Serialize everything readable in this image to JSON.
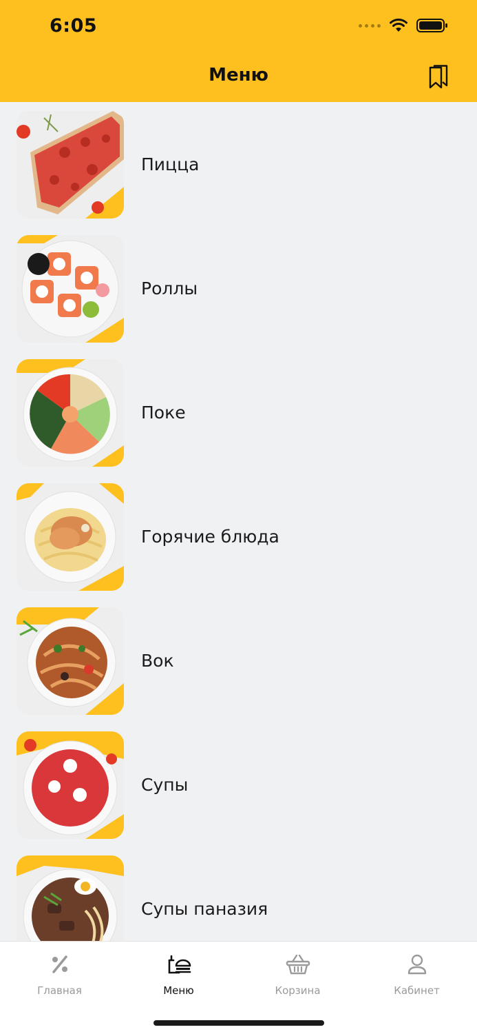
{
  "status_bar": {
    "time": "6:05"
  },
  "nav": {
    "title": "Меню",
    "bookmark_icon": "bookmark-icon"
  },
  "categories": [
    {
      "label": "Пицца",
      "image": "pizza-image"
    },
    {
      "label": "Роллы",
      "image": "rolls-image"
    },
    {
      "label": "Поке",
      "image": "poke-image"
    },
    {
      "label": "Горячие блюда",
      "image": "hot-dishes-image"
    },
    {
      "label": "Вок",
      "image": "wok-image"
    },
    {
      "label": "Супы",
      "image": "soup-image"
    },
    {
      "label": "Супы паназия",
      "image": "panasian-soup-image"
    }
  ],
  "tabbar": {
    "tabs": [
      {
        "label": "Главная",
        "icon": "percent-icon",
        "active": false
      },
      {
        "label": "Меню",
        "icon": "menu-food-icon",
        "active": true
      },
      {
        "label": "Корзина",
        "icon": "basket-icon",
        "active": false
      },
      {
        "label": "Кабинет",
        "icon": "user-icon",
        "active": false
      }
    ]
  },
  "colors": {
    "accent": "#fec01e",
    "background": "#f0f1f3",
    "tab_inactive": "#9a9a9a",
    "tab_active": "#111111"
  }
}
